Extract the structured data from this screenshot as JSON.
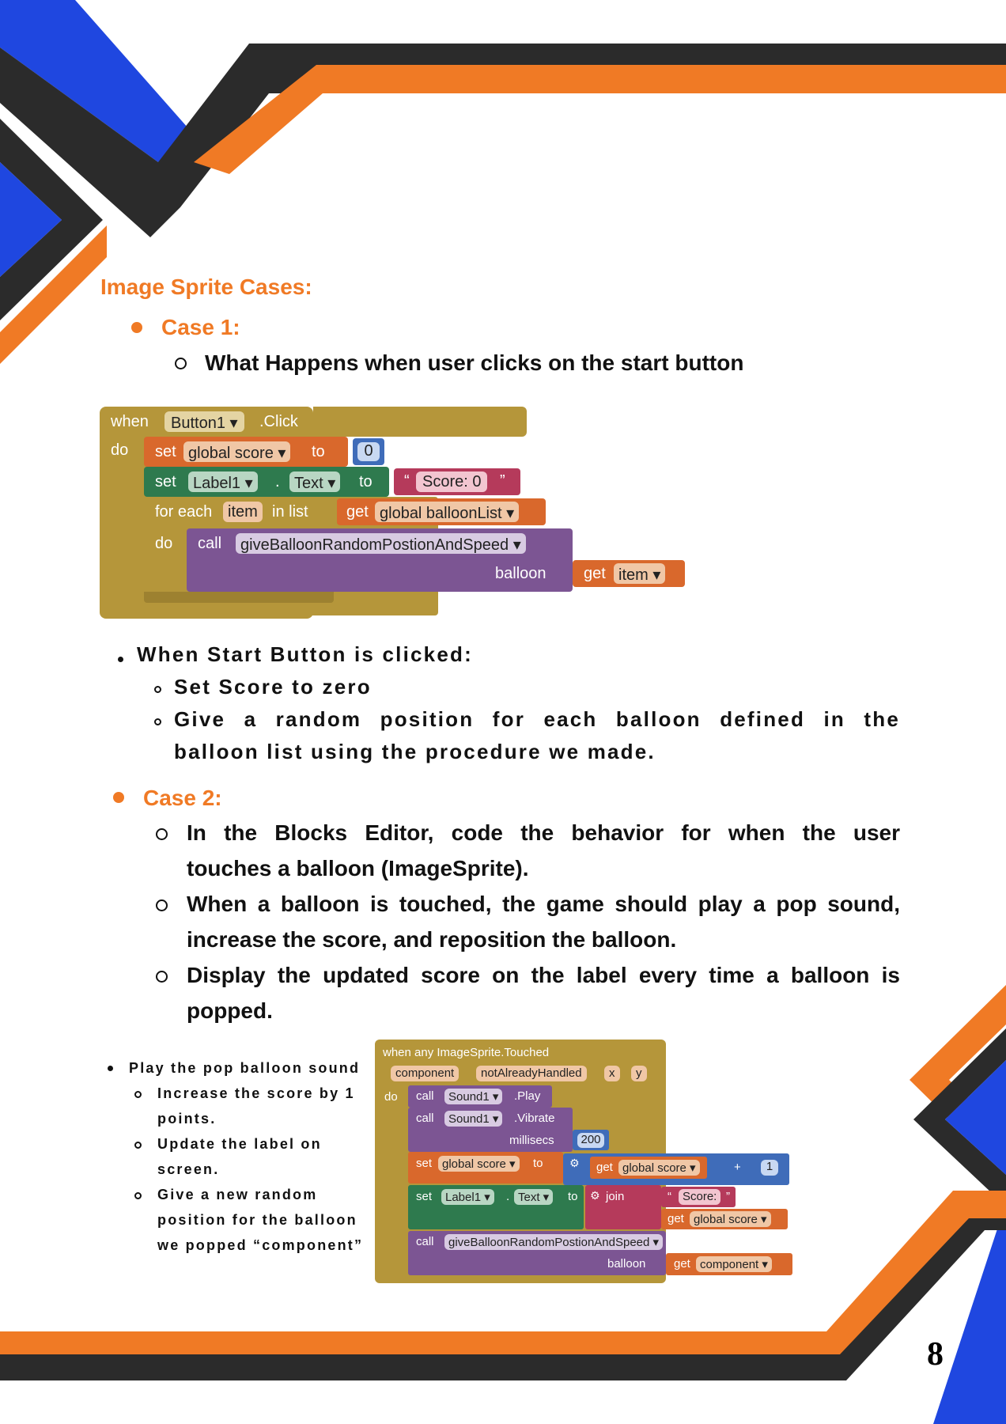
{
  "colors": {
    "orange": "#f07a25",
    "blue": "#1f47e0",
    "dark": "#2b2b2b"
  },
  "heading": "Image Sprite Cases:",
  "case1": {
    "label": "Case 1:",
    "item": "What Happens when user clicks on the start button",
    "blocks": {
      "when": "when",
      "component": "Button1",
      "event": ".Click",
      "do": "do",
      "set": "set",
      "global_score": "global score",
      "to": "to",
      "zero": "0",
      "set2": "set",
      "label1": "Label1",
      "dot": ".",
      "text_prop": "Text",
      "to2": "to",
      "q_open": "“",
      "score_text": "Score: 0",
      "q_close": "”",
      "for_each": "for each",
      "item_var": "item",
      "in_list": "in list",
      "get": "get",
      "balloon_list": "global balloonList",
      "do2": "do",
      "call": "call",
      "procedure": "giveBalloonRandomPostionAndSpeed",
      "balloon": "balloon",
      "get2": "get",
      "item_get": "item"
    },
    "summary_title": "When Start Button is clicked:",
    "summary_items": [
      "Set Score to zero",
      "Give a random position for each balloon defined in the",
      "balloon list using the procedure we made."
    ]
  },
  "case2": {
    "label": "Case 2:",
    "items": [
      [
        "In the Blocks Editor, code the behavior for when the user",
        "touches a balloon (ImageSprite)."
      ],
      [
        "When a balloon is touched, the game should play a pop sound,",
        "increase the score, and reposition the balloon."
      ],
      [
        "Display the updated score on the label every time a balloon is",
        "popped."
      ]
    ],
    "notes": {
      "main": "Play the pop balloon sound",
      "sub": [
        [
          "Increase the score by 1",
          "points."
        ],
        [
          "Update the label on",
          "screen."
        ],
        [
          "Give a new random",
          "position for the balloon",
          "we popped “component”"
        ]
      ]
    },
    "blocks": {
      "event": "when any ImageSprite.Touched",
      "params": [
        "component",
        "notAlreadyHandled",
        "x",
        "y"
      ],
      "do": "do",
      "call1": "call",
      "sound1": "Sound1",
      "play": ".Play",
      "call2": "call",
      "sound2": "Sound1",
      "vibrate": ".Vibrate",
      "millisecs": "millisecs",
      "ms_value": "200",
      "set": "set",
      "global_score": "global score",
      "to": "to",
      "get": "get",
      "global_score2": "global score",
      "plus": "+",
      "one": "1",
      "set2": "set",
      "label1": "Label1",
      "dot": ".",
      "text_prop": "Text",
      "to2": "to",
      "join": "join",
      "q_open": "“",
      "score_text": "Score:",
      "q_close": "”",
      "get2": "get",
      "global_score3": "global score",
      "call3": "call",
      "procedure": "giveBalloonRandomPostionAndSpeed",
      "balloon": "balloon",
      "get3": "get",
      "component": "component"
    }
  },
  "page_number": "8"
}
